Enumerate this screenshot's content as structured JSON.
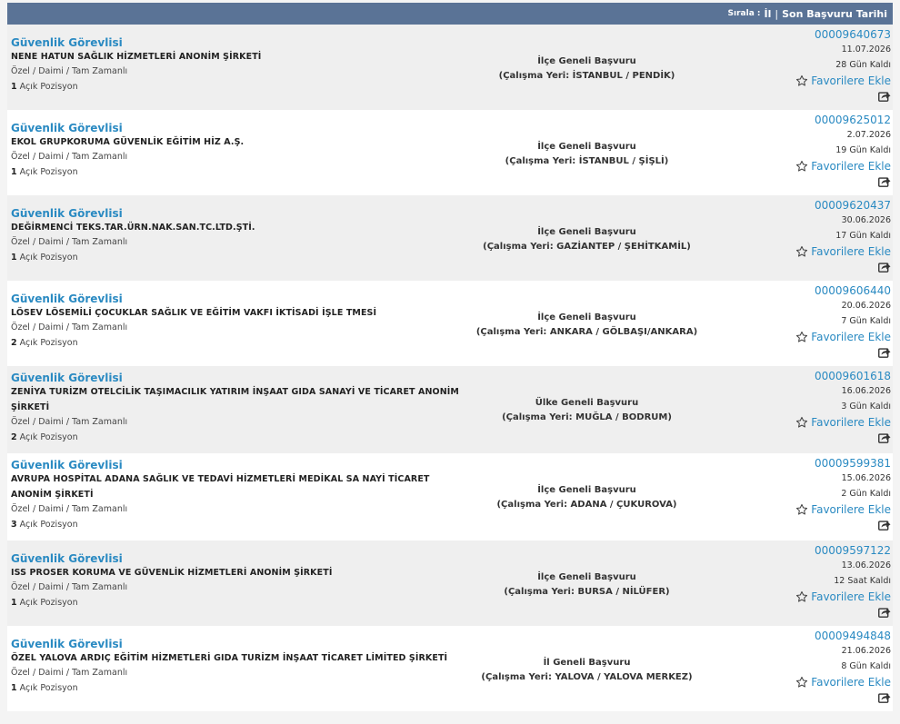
{
  "sort": {
    "label": "Sırala :",
    "option_province": "İl",
    "separator": "|",
    "option_last_date": "Son Başvuru Tarihi"
  },
  "listings": [
    {
      "title": "Güvenlik Görevlisi",
      "company": "NENE HATUN SAĞLIK HİZMETLERİ ANONİM ŞİRKETİ",
      "type": "Özel / Daimi / Tam Zamanlı",
      "count": "1",
      "count_label": "Açık Pozisyon",
      "scope": "İlçe Geneli Başvuru",
      "location": "(Çalışma Yeri: İSTANBUL / PENDİK)",
      "code": "00009640673",
      "date": "11.07.2026",
      "remaining": "28 Gün Kaldı",
      "fav_label": "Favorilere Ekle"
    },
    {
      "title": "Güvenlik Görevlisi",
      "company": "EKOL GRUPKORUMA GÜVENLİK EĞİTİM HİZ A.Ş.",
      "type": "Özel / Daimi / Tam Zamanlı",
      "count": "1",
      "count_label": "Açık Pozisyon",
      "scope": "İlçe Geneli Başvuru",
      "location": "(Çalışma Yeri: İSTANBUL / ŞİŞLİ)",
      "code": "00009625012",
      "date": "2.07.2026",
      "remaining": "19 Gün Kaldı",
      "fav_label": "Favorilere Ekle"
    },
    {
      "title": "Güvenlik Görevlisi",
      "company": "DEĞİRMENCİ TEKS.TAR.ÜRN.NAK.SAN.TC.LTD.ŞTİ.",
      "type": "Özel / Daimi / Tam Zamanlı",
      "count": "1",
      "count_label": "Açık Pozisyon",
      "scope": "İlçe Geneli Başvuru",
      "location": "(Çalışma Yeri: GAZİANTEP / ŞEHİTKAMİL)",
      "code": "00009620437",
      "date": "30.06.2026",
      "remaining": "17 Gün Kaldı",
      "fav_label": "Favorilere Ekle"
    },
    {
      "title": "Güvenlik Görevlisi",
      "company": "LÖSEV LÖSEMİLİ ÇOCUKLAR SAĞLIK VE EĞİTİM VAKFI İKTİSADİ İŞLE TMESİ",
      "type": "Özel / Daimi / Tam Zamanlı",
      "count": "2",
      "count_label": "Açık Pozisyon",
      "scope": "İlçe Geneli Başvuru",
      "location": "(Çalışma Yeri: ANKARA / GÖLBAŞI/ANKARA)",
      "code": "00009606440",
      "date": "20.06.2026",
      "remaining": "7 Gün Kaldı",
      "fav_label": "Favorilere Ekle"
    },
    {
      "title": "Güvenlik Görevlisi",
      "company": "ZENİYA TURİZM OTELCİLİK TAŞIMACILIK YATIRIM İNŞAAT GIDA SANAYİ VE TİCARET ANONİM ŞİRKETİ",
      "type": "Özel / Daimi / Tam Zamanlı",
      "count": "2",
      "count_label": "Açık Pozisyon",
      "scope": "Ülke Geneli Başvuru",
      "location": "(Çalışma Yeri: MUĞLA / BODRUM)",
      "code": "00009601618",
      "date": "16.06.2026",
      "remaining": "3 Gün Kaldı",
      "fav_label": "Favorilere Ekle"
    },
    {
      "title": "Güvenlik Görevlisi",
      "company": "AVRUPA HOSPİTAL ADANA SAĞLIK VE TEDAVİ HİZMETLERİ MEDİKAL SA NAYİ TİCARET ANONİM ŞİRKETİ",
      "type": "Özel / Daimi / Tam Zamanlı",
      "count": "3",
      "count_label": "Açık Pozisyon",
      "scope": "İlçe Geneli Başvuru",
      "location": "(Çalışma Yeri: ADANA / ÇUKUROVA)",
      "code": "00009599381",
      "date": "15.06.2026",
      "remaining": "2 Gün Kaldı",
      "fav_label": "Favorilere Ekle"
    },
    {
      "title": "Güvenlik Görevlisi",
      "company": "ISS PROSER KORUMA VE GÜVENLİK HİZMETLERİ ANONİM ŞİRKETİ",
      "type": "Özel / Daimi / Tam Zamanlı",
      "count": "1",
      "count_label": "Açık Pozisyon",
      "scope": "İlçe Geneli Başvuru",
      "location": "(Çalışma Yeri: BURSA / NİLÜFER)",
      "code": "00009597122",
      "date": "13.06.2026",
      "remaining": "12 Saat Kaldı",
      "fav_label": "Favorilere Ekle"
    },
    {
      "title": "Güvenlik Görevlisi",
      "company": "ÖZEL YALOVA ARDIÇ EĞİTİM HİZMETLERİ GIDA TURİZM İNŞAAT TİCARET LİMİTED ŞİRKETİ",
      "type": "Özel / Daimi / Tam Zamanlı",
      "count": "1",
      "count_label": "Açık Pozisyon",
      "scope": "İl Geneli Başvuru",
      "location": "(Çalışma Yeri: YALOVA / YALOVA MERKEZ)",
      "code": "00009494848",
      "date": "21.06.2026",
      "remaining": "8 Gün Kaldı",
      "fav_label": "Favorilere Ekle"
    }
  ]
}
